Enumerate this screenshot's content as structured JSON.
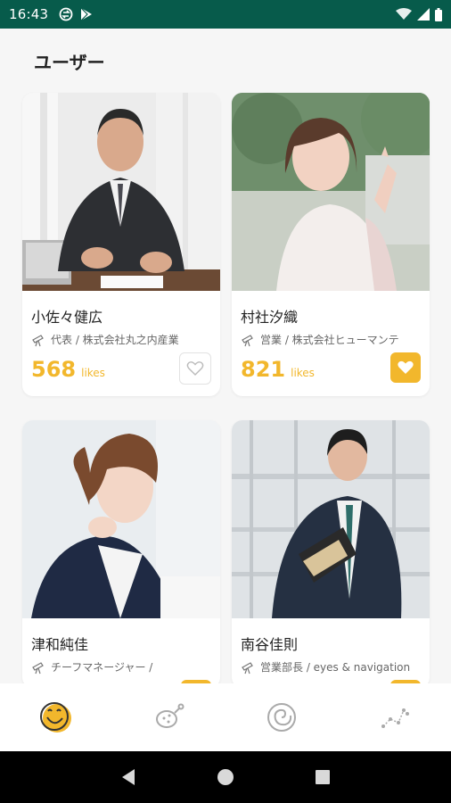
{
  "status": {
    "time": "16:43"
  },
  "header": {
    "title": "ユーザー"
  },
  "users": [
    {
      "name": "小佐々健広",
      "role": "代表 / 株式会社丸之内産業",
      "likes": "568",
      "likes_label": "likes",
      "liked": false
    },
    {
      "name": "村社汐織",
      "role": "営業 / 株式会社ヒューマンテ",
      "likes": "821",
      "likes_label": "likes",
      "liked": true
    },
    {
      "name": "津和純佳",
      "role": "チーフマネージャー /",
      "likes": "",
      "likes_label": "",
      "liked": true
    },
    {
      "name": "南谷佳則",
      "role": "営業部長 / eyes & navigation",
      "likes": "",
      "likes_label": "",
      "liked": true
    }
  ],
  "nav": {
    "items": [
      "smile-face-icon",
      "meat-icon",
      "spiral-icon",
      "constellation-icon"
    ],
    "active": 0
  },
  "colors": {
    "accent": "#f2b72c",
    "statusbar": "#075b4b"
  }
}
